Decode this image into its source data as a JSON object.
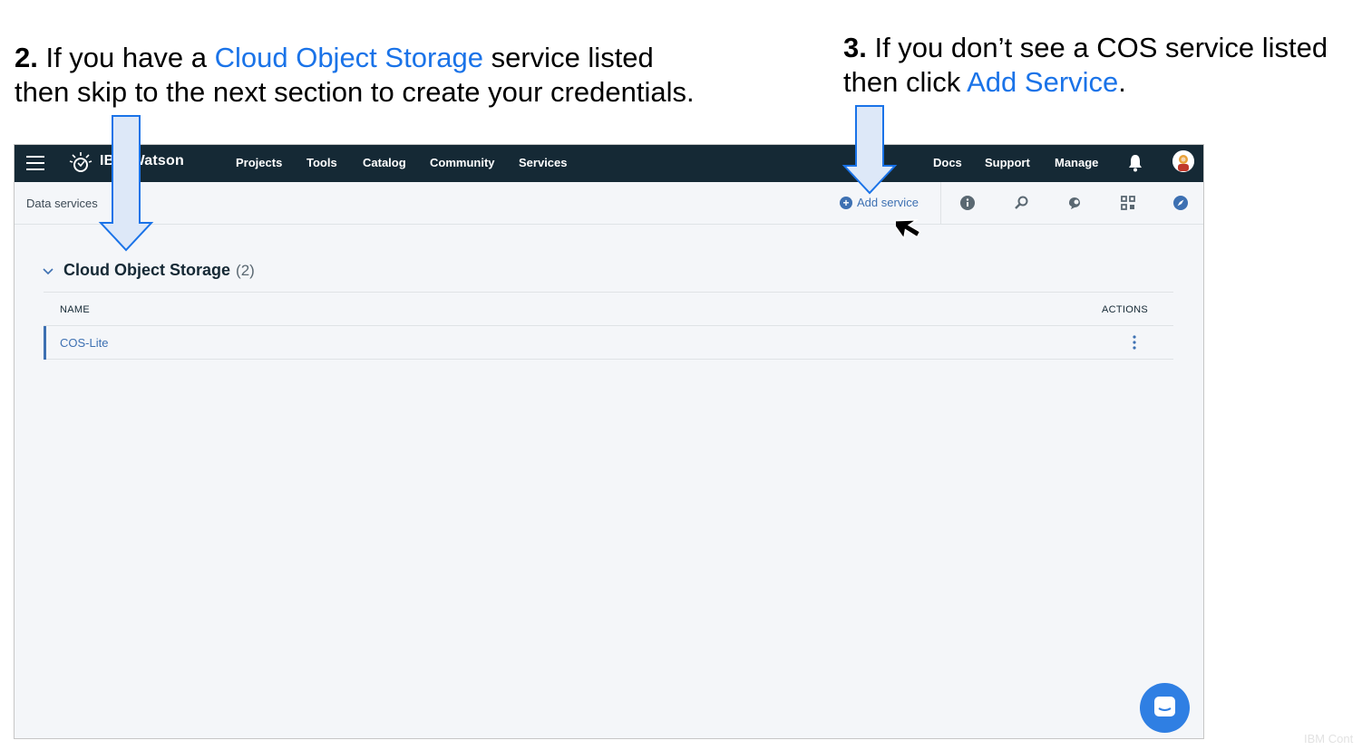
{
  "callouts": {
    "left": {
      "step": "2.",
      "pre": " If you have a ",
      "highlight": "Cloud Object Storage",
      "post": " service listed",
      "line2": "then skip to the next section to create your credentials."
    },
    "right": {
      "step": "3.",
      "line1": " If you don’t see a COS service listed",
      "pre2": "then click ",
      "highlight": "Add Service",
      "post2": "."
    }
  },
  "app": {
    "brand": "IBM Watson",
    "nav": [
      "Projects",
      "Tools",
      "Catalog",
      "Community",
      "Services"
    ],
    "nav_right": [
      "Docs",
      "Support",
      "Manage"
    ]
  },
  "subbar": {
    "breadcrumb": "Data services",
    "add_service": "Add service",
    "tool_icons": [
      "info-icon",
      "wrench-icon",
      "chat-bubbles-icon",
      "grid-icon",
      "compass-icon"
    ]
  },
  "section": {
    "title": "Cloud Object Storage",
    "count": "(2)"
  },
  "table": {
    "columns": [
      "NAME",
      "ACTIONS"
    ],
    "rows": [
      {
        "name": "COS-Lite"
      }
    ]
  },
  "colors": {
    "nav_bg": "#152935",
    "link_blue": "#3d70b2",
    "callout_highlight": "#1a73e8",
    "arrow_fill": "#dde8f8",
    "arrow_stroke": "#1a73e8"
  },
  "watermark": "IBM Cont"
}
